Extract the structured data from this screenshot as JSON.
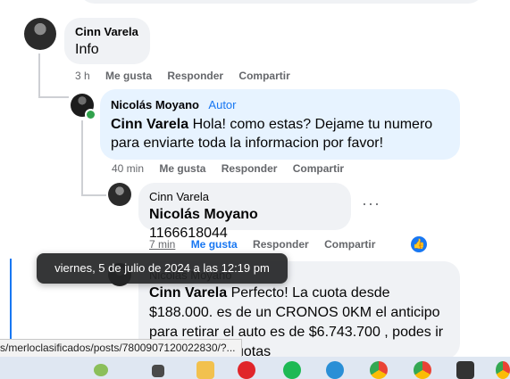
{
  "comments": [
    {
      "author": "Cinn Varela",
      "text": "Info",
      "actions": {
        "time": "3 h",
        "like": "Me gusta",
        "reply": "Responder",
        "share": "Compartir"
      }
    },
    {
      "author": "Nicolás Moyano",
      "badge": "Autor",
      "mention": "Cinn Varela",
      "text": " Hola! como estas? Dejame tu numero para enviarte toda la informacion por favor!",
      "actions": {
        "time": "40 min",
        "like": "Me gusta",
        "reply": "Responder",
        "share": "Compartir"
      }
    },
    {
      "author": "Cinn Varela",
      "mention": "Nicolás Moyano",
      "text": " 1166618044",
      "more": "···",
      "actions": {
        "time": "7 min",
        "like": "Me gusta",
        "reply": "Responder",
        "share": "Compartir"
      }
    },
    {
      "author": "Nicolás Moyano",
      "mention": "Cinn Varela",
      "text": " Perfecto! La cuota desde $188.000. es de un CRONOS 0KM el anticipo para retirar el auto es de $6.743.700 , podes ir pagando en cuotas"
    }
  ],
  "tooltip": "viernes, 5 de julio de 2024 a las 12:19 pm",
  "status_url": "s/merloclasificados/posts/7800907120022830/?...",
  "colors": {
    "accent": "#1877f2",
    "online": "#31a24c"
  }
}
